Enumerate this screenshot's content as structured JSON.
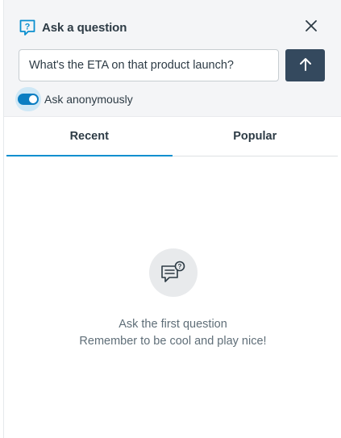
{
  "header": {
    "title": "Ask a question",
    "title_icon": "question-bubble-icon",
    "close_icon": "close-icon"
  },
  "question_form": {
    "input_value": "What's the ETA on that product launch?",
    "submit_icon": "arrow-up-icon"
  },
  "anonymous_toggle": {
    "label": "Ask anonymously",
    "checked": true
  },
  "tabs": [
    {
      "label": "Recent",
      "active": true
    },
    {
      "label": "Popular",
      "active": false
    }
  ],
  "empty_state": {
    "icon": "chat-question-icon",
    "line1": "Ask the first question",
    "line2": "Remember to be cool and play nice!"
  },
  "colors": {
    "accent": "#0b8fcf",
    "submit_bg": "#34495e",
    "header_bg": "#f4f5f7"
  }
}
